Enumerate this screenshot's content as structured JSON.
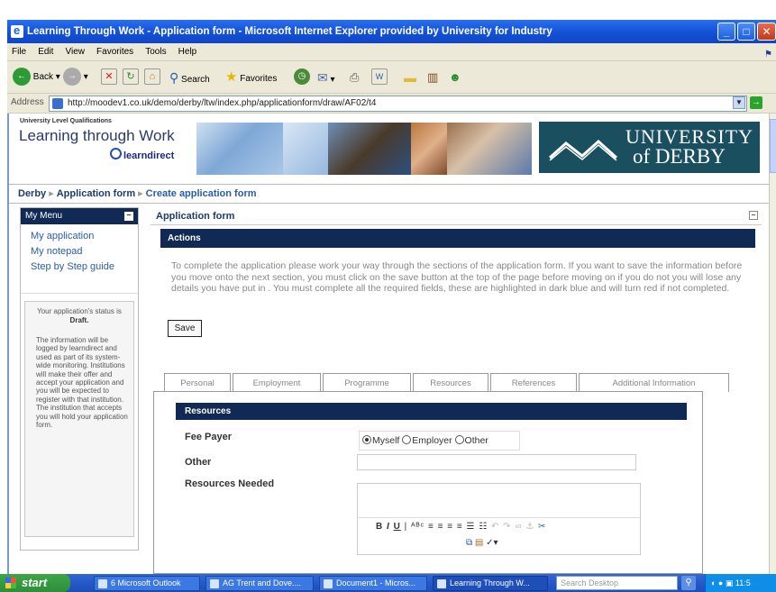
{
  "window": {
    "title": "Learning Through Work - Application form - Microsoft Internet Explorer provided by University for Industry"
  },
  "menubar": [
    "File",
    "Edit",
    "View",
    "Favorites",
    "Tools",
    "Help"
  ],
  "toolbar": {
    "back": "Back",
    "search": "Search",
    "favorites": "Favorites"
  },
  "address": {
    "label": "Address",
    "url": "http://moodev1.co.uk/demo/derby/ltw/index.php/applicationform/draw/AF02/t4",
    "go": "Go"
  },
  "header": {
    "qualifications": "University Level Qualifications",
    "logo": "Learning through Work",
    "learndirect": "learndirect",
    "university": "UNIVERSITY",
    "of_derby": "of DERBY"
  },
  "breadcrumb": [
    "Derby",
    "Application form",
    "Create application form"
  ],
  "menu": {
    "title": "My Menu",
    "links": [
      "My application",
      "My notepad",
      "Step by Step guide"
    ],
    "status_prefix": "Your application's status is",
    "status_value": "Draft.",
    "info": "The information will be logged by learndirect and used as part of its system-wide monitoring. Institutions will make their offer and accept your application and you will be expected to register with that institution. The institution that accepts you will hold your application form."
  },
  "content": {
    "heading": "Application form",
    "actions_title": "Actions",
    "actions_text": "To complete the application please work your way through the sections of the application form. If you want to save the information before you move onto the next section, you must click on the save button at the top of the page before moving on if you do not you will lose any details you have put in . You must complete all the required fields, these are highlighted in dark blue and will turn red if not completed.",
    "save": "Save"
  },
  "tabs": [
    "Personal",
    "Employment",
    "Programme",
    "Resources",
    "References",
    "Additional Information"
  ],
  "resources": {
    "title": "Resources",
    "fee_payer_label": "Fee Payer",
    "fee_options": [
      "Myself",
      "Employer",
      "Other"
    ],
    "fee_selected": "Myself",
    "other_label": "Other",
    "other_value": "",
    "needed_label": "Resources Needed",
    "needed_value": ""
  },
  "taskbar": {
    "start": "start",
    "tasks": [
      "6 Microsoft Outlook",
      "AG Trent and Dove....",
      "Document1 - Micros...",
      "Learning Through W..."
    ],
    "search_placeholder": "Search Desktop",
    "clock": "11:5"
  }
}
